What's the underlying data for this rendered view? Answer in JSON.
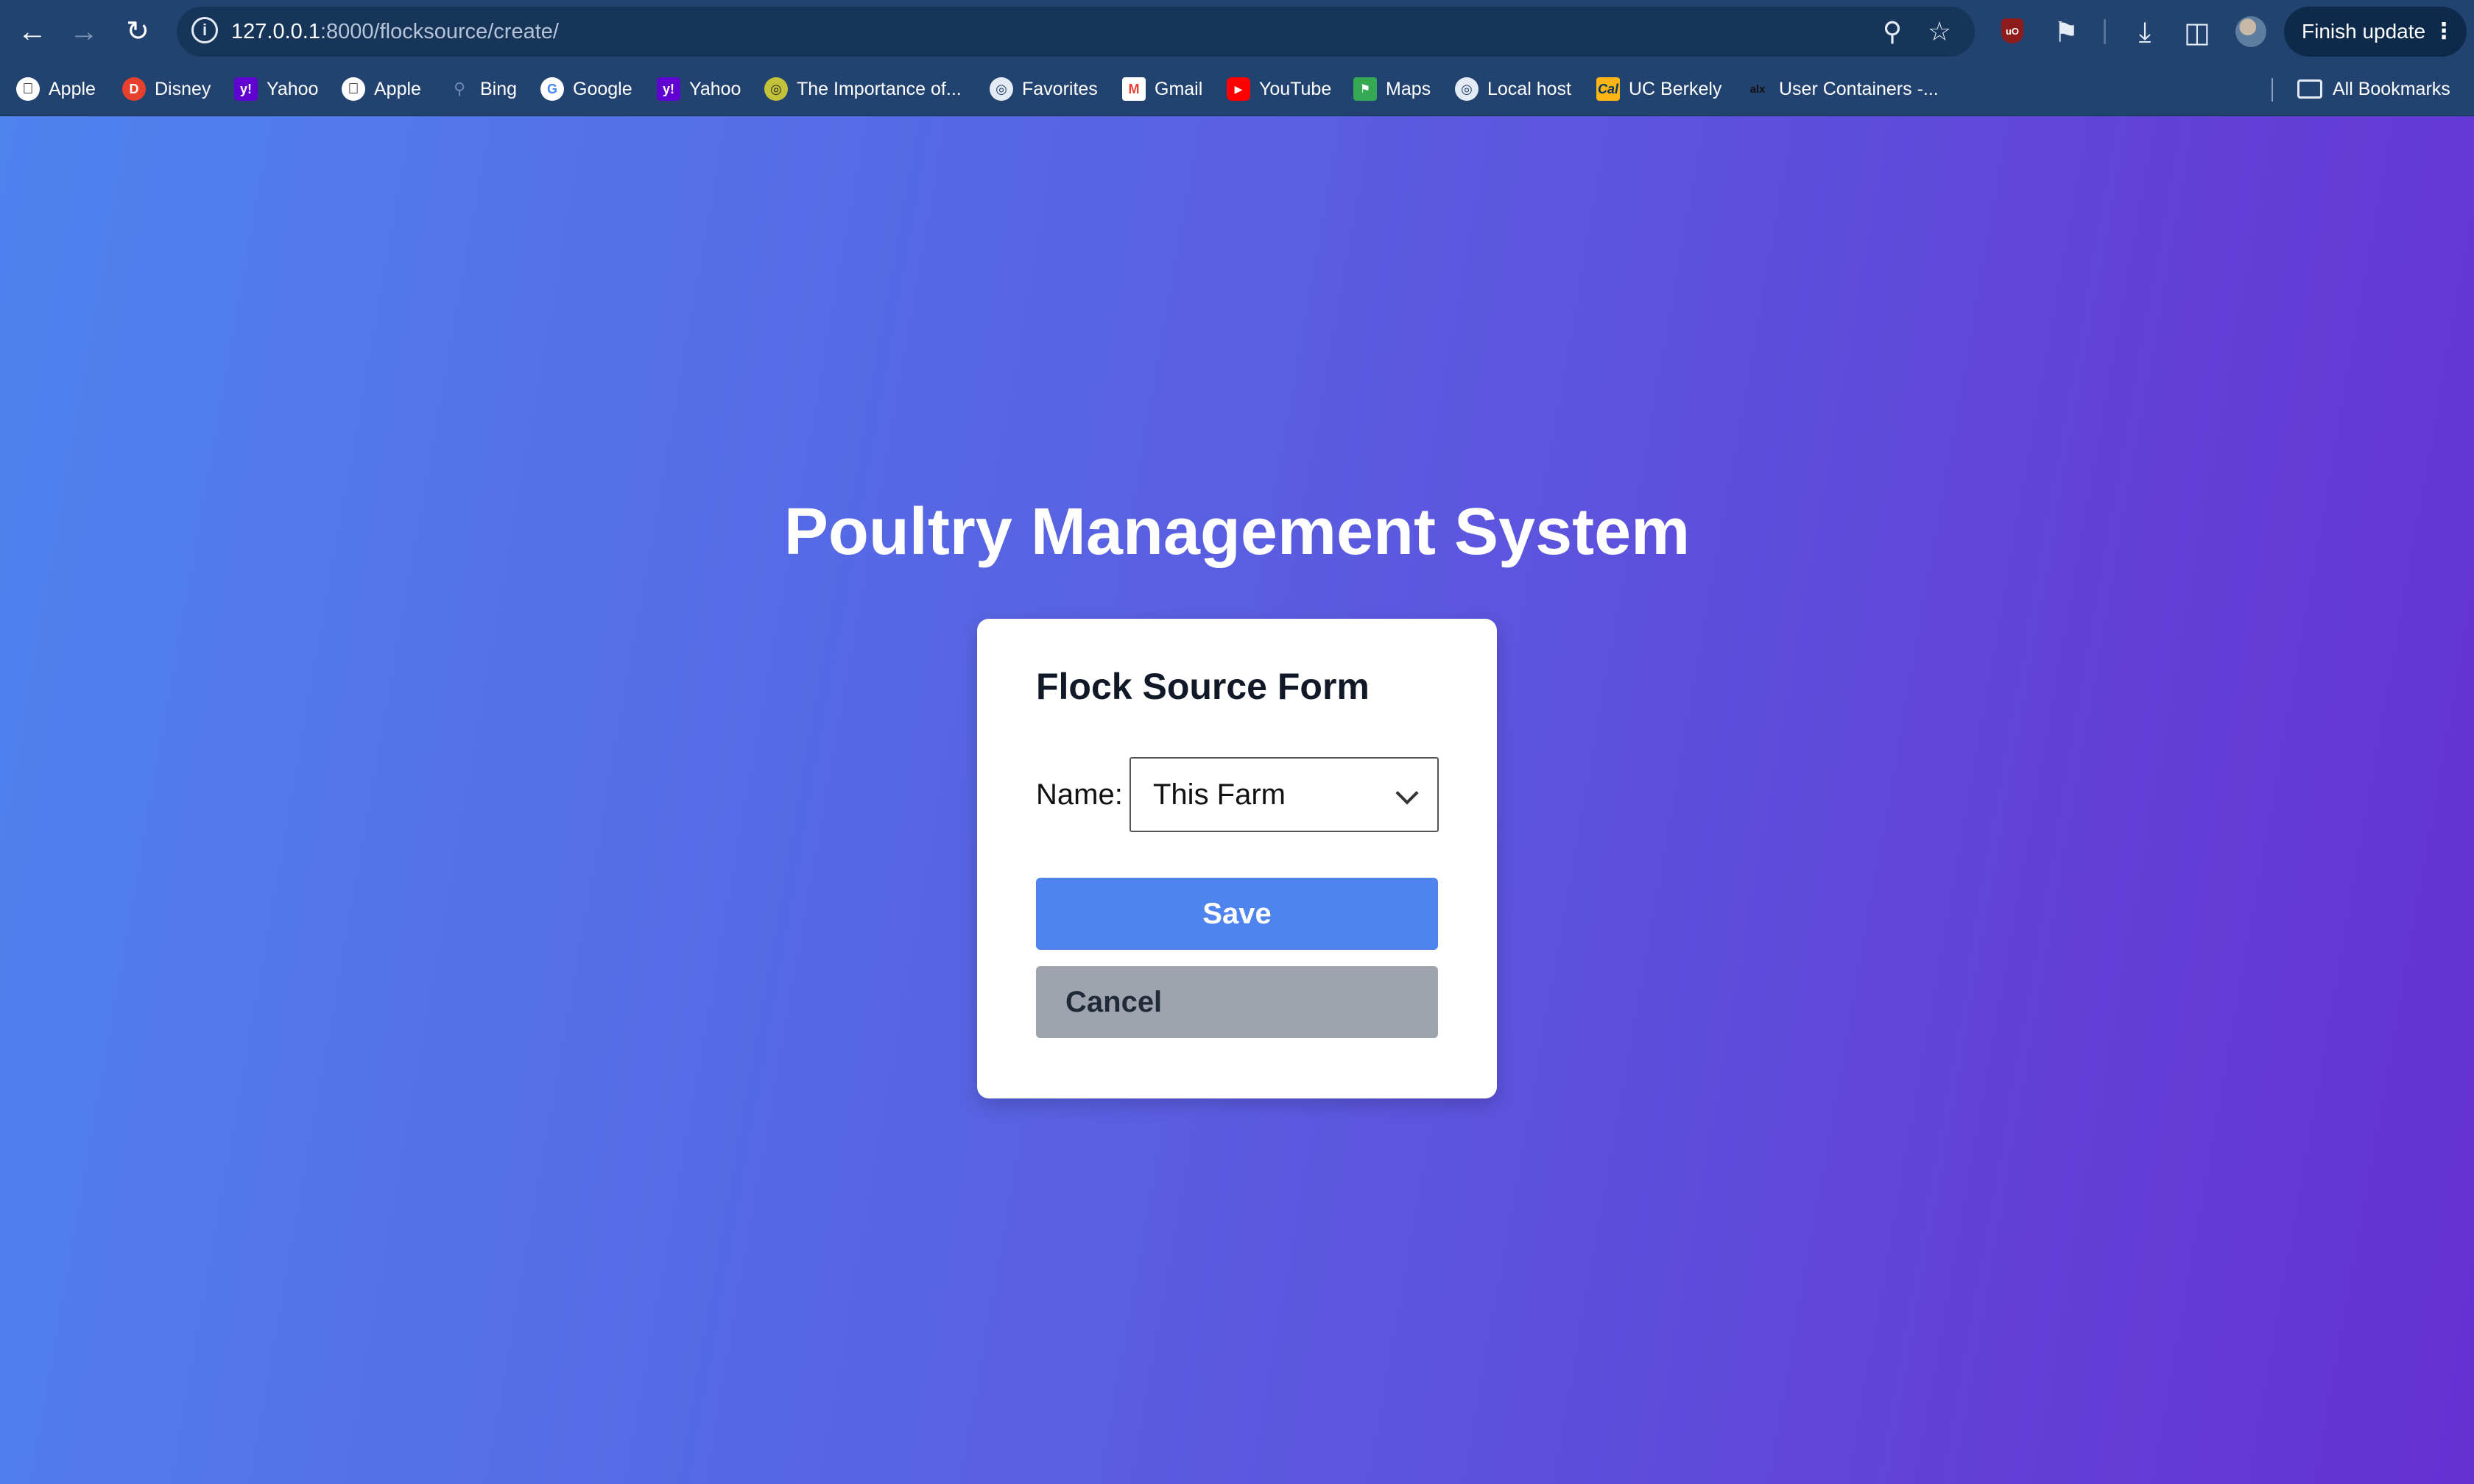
{
  "browser": {
    "url_host": "127.0.0.1",
    "url_path": ":8000/flocksource/create/",
    "finish_update_label": "Finish update",
    "bookmarks": [
      {
        "label": "Apple",
        "icon": "apple-icon"
      },
      {
        "label": "Disney",
        "icon": "disney-icon"
      },
      {
        "label": "Yahoo",
        "icon": "yahoo-icon"
      },
      {
        "label": "Apple",
        "icon": "apple-icon"
      },
      {
        "label": "Bing",
        "icon": "bing-icon"
      },
      {
        "label": "Google",
        "icon": "google-icon"
      },
      {
        "label": "Yahoo",
        "icon": "yahoo-icon"
      },
      {
        "label": "The Importance of...",
        "icon": "globe-icon"
      },
      {
        "label": "Favorites",
        "icon": "globe-icon"
      },
      {
        "label": "Gmail",
        "icon": "gmail-icon"
      },
      {
        "label": "YouTube",
        "icon": "youtube-icon"
      },
      {
        "label": "Maps",
        "icon": "maps-icon"
      },
      {
        "label": "Local host",
        "icon": "globe-icon"
      },
      {
        "label": "UC Berkely",
        "icon": "cal-icon"
      },
      {
        "label": "User Containers -...",
        "icon": "alx-icon"
      }
    ],
    "all_bookmarks_label": "All Bookmarks"
  },
  "page": {
    "app_title": "Poultry Management System",
    "form": {
      "title": "Flock Source Form",
      "name_label": "Name:",
      "name_selected": "This Farm",
      "save_label": "Save",
      "cancel_label": "Cancel"
    }
  },
  "colors": {
    "chrome_bg": "#22436f",
    "save_button": "#4f83ee",
    "cancel_button": "#9ea3ad",
    "gradient_start": "#4f83ee",
    "gradient_end": "#6630d3"
  }
}
